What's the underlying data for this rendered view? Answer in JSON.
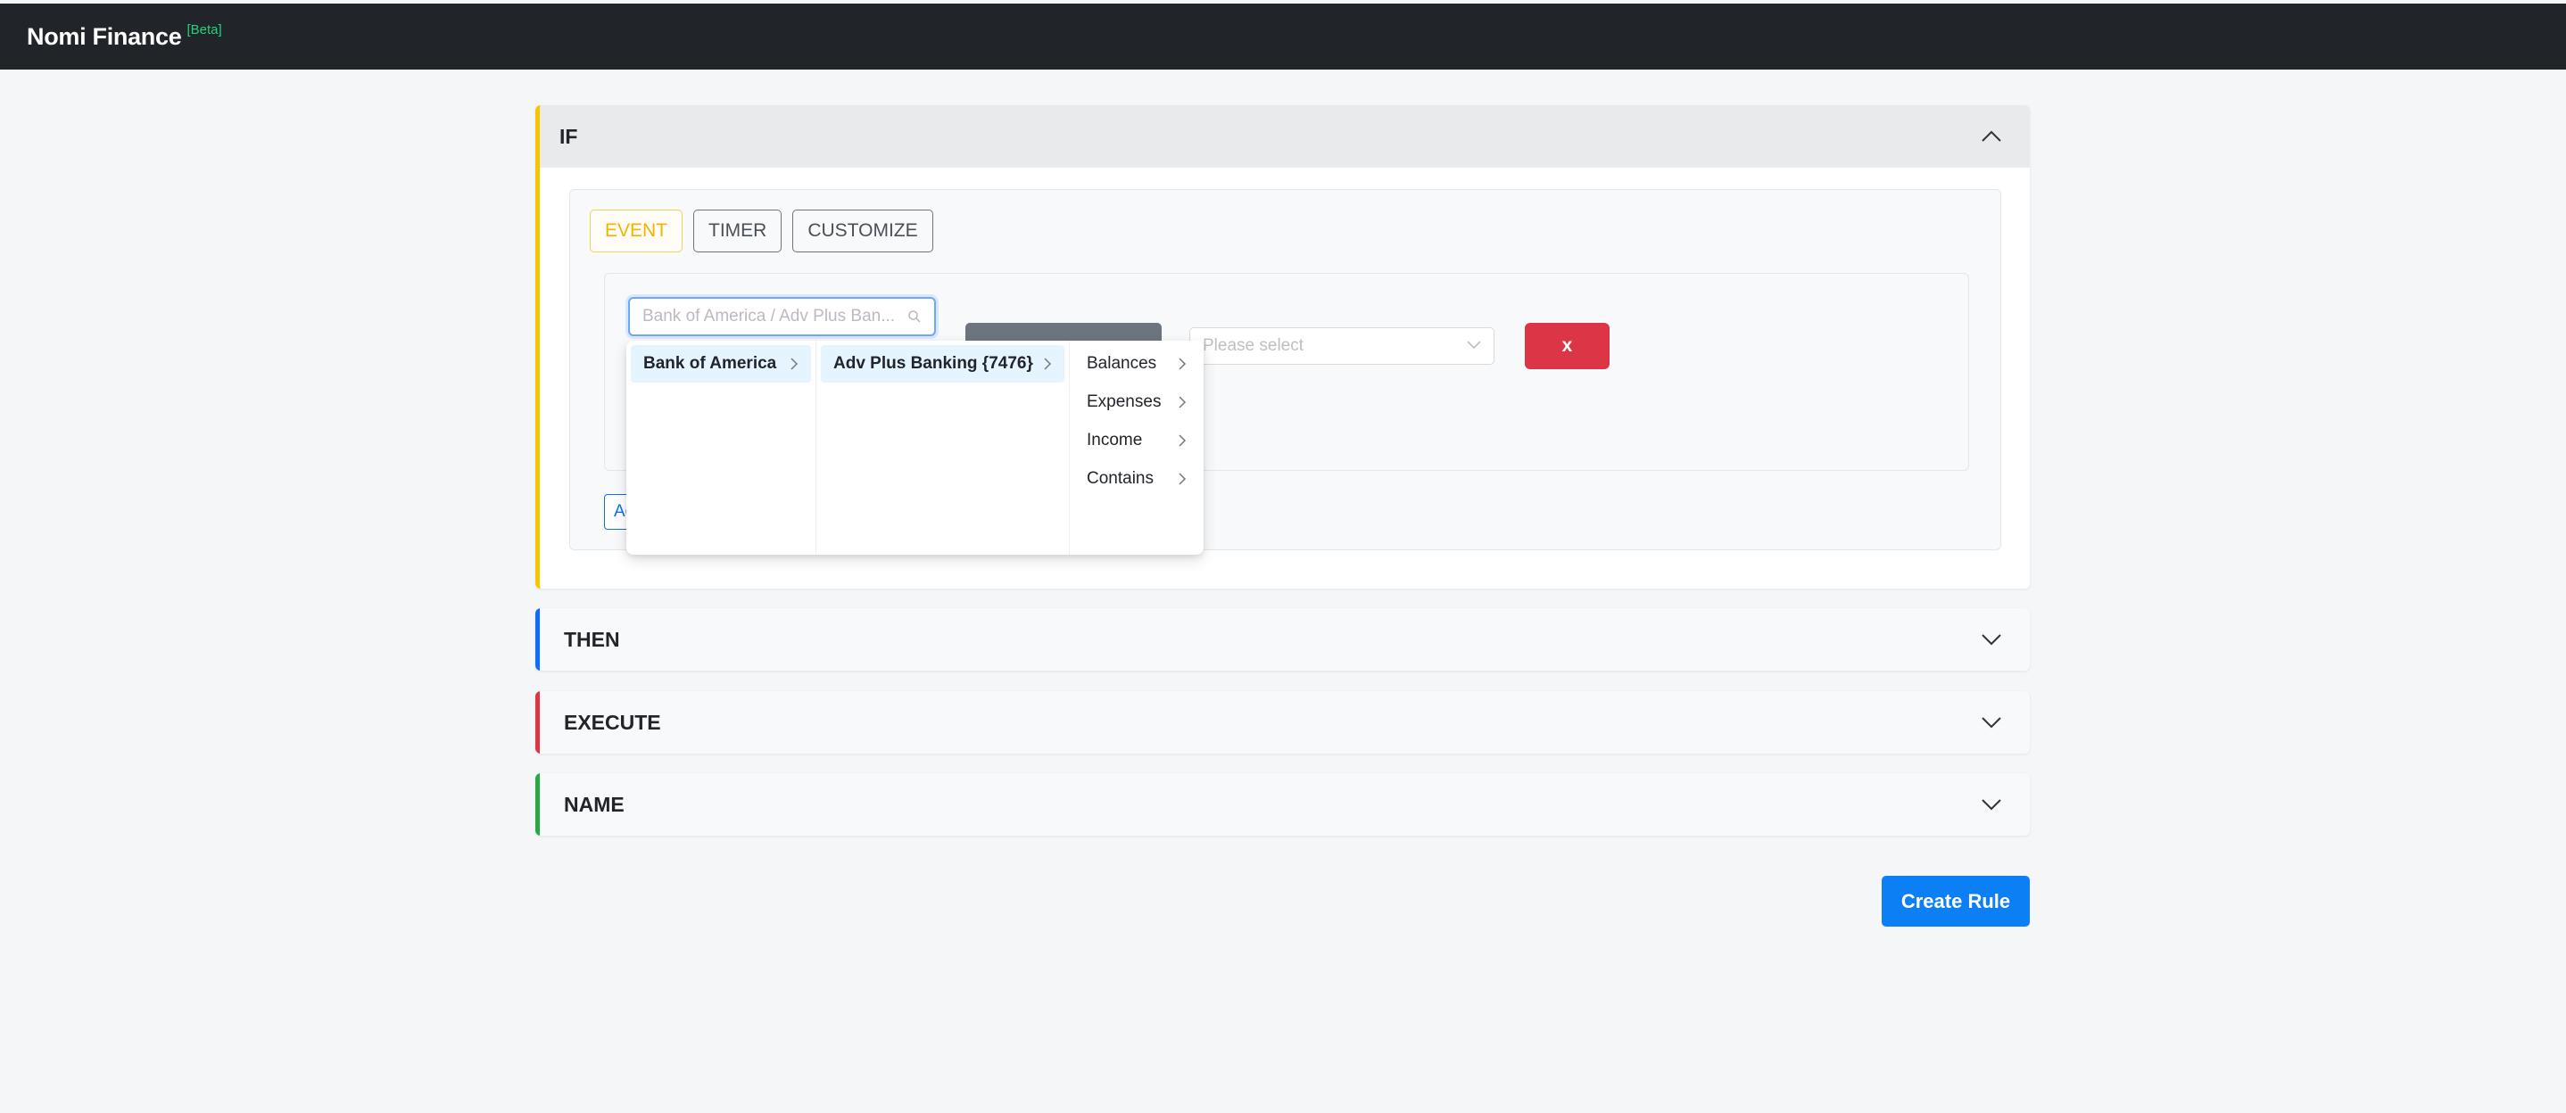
{
  "app": {
    "title": "Nomi Finance",
    "badge": "[Beta]"
  },
  "sections": {
    "if": {
      "title": "IF"
    },
    "then": {
      "title": "THEN"
    },
    "execute": {
      "title": "EXECUTE"
    },
    "name": {
      "title": "NAME"
    }
  },
  "tabs": [
    {
      "label": "EVENT",
      "active": true
    },
    {
      "label": "TIMER",
      "active": false
    },
    {
      "label": "CUSTOMIZE",
      "active": false
    }
  ],
  "condition": {
    "cascader_placeholder": "Bank of America / Adv Plus Ban...",
    "select_placeholder": "Please select",
    "remove_label": "x",
    "add_label": "Add"
  },
  "cascader_menu": {
    "column_1": [
      {
        "label": "Bank of America",
        "active": true
      }
    ],
    "column_2": [
      {
        "label": "Adv Plus Banking {7476}",
        "active": true
      }
    ],
    "column_3": [
      {
        "label": "Balances"
      },
      {
        "label": "Expenses"
      },
      {
        "label": "Income"
      },
      {
        "label": "Contains"
      }
    ]
  },
  "footer": {
    "create_label": "Create Rule"
  },
  "colors": {
    "if_accent": "#f7c500",
    "then_accent": "#0d6efd",
    "execute_accent": "#dc3545",
    "name_accent": "#28a745",
    "primary": "#0d7ff5",
    "danger": "#dc3545"
  }
}
